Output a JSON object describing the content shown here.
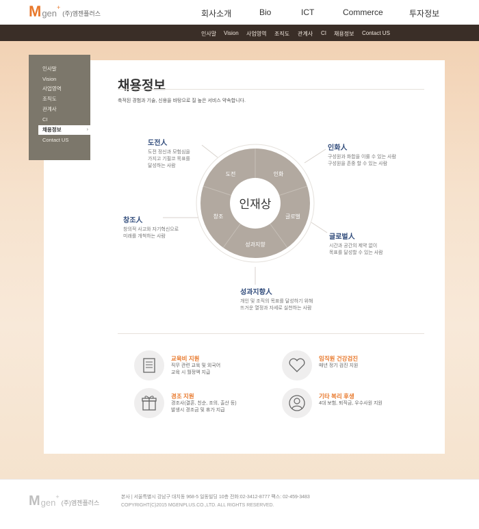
{
  "logo": {
    "m": "M",
    "gen": "gen",
    "plus": "+",
    "corp": "(주)엠젠플러스"
  },
  "gnb": [
    "회사소개",
    "Bio",
    "ICT",
    "Commerce",
    "투자정보"
  ],
  "lnb": [
    "인사말",
    "Vision",
    "사업영역",
    "조직도",
    "관계사",
    "CI",
    "채용정보",
    "Contact US"
  ],
  "side": {
    "items": [
      "인사말",
      "Vision",
      "사업영역",
      "조직도",
      "관계사",
      "CI",
      "채용정보",
      "Contact US"
    ],
    "active_index": 6,
    "active_arrow": "›"
  },
  "page": {
    "title": "채용정보",
    "desc": "축적된 경험과 기술, 신용을 바탕으로 질 높은 서비스 약속합니다."
  },
  "diagram": {
    "center": "인재상",
    "segments": [
      "도전",
      "인화",
      "글로벌",
      "성과지향",
      "창조"
    ]
  },
  "traits": [
    {
      "title": "도전人",
      "desc": [
        "도전 정신과 모험심을",
        "가지고 기필코 목표를",
        "달성하는 사람"
      ]
    },
    {
      "title": "인화人",
      "desc": [
        "구성원과 화합을 이룰 수 있는 사람",
        "구성원을 존중 할 수 있는 사람"
      ]
    },
    {
      "title": "창조人",
      "desc": [
        "창의적 사고와 자기혁신으로",
        "미래를 개척하는 사람"
      ]
    },
    {
      "title": "글로벌人",
      "desc": [
        "시간과 공간의 제약 없이",
        "목표를 달성할 수 있는 사람"
      ]
    },
    {
      "title": "성과지향人",
      "desc": [
        "개인 및 조직의 목표를 달성하기 위해",
        "뜨거운 열정과 자세로 실천하는 사람"
      ]
    }
  ],
  "benefits": [
    {
      "icon": "document-icon",
      "title": "교육비 지원",
      "desc": [
        "직무 관련 교육 및 외국어",
        "교육 시 월정액 지급"
      ]
    },
    {
      "icon": "heart-icon",
      "title": "임직원 건강검진",
      "desc": [
        "매년 정기 검진 지원"
      ]
    },
    {
      "icon": "gift-icon",
      "title": "경조 지원",
      "desc": [
        "경조사(결혼, 친순, 조의, 출산 등)",
        "발생시 경조금 및 휴가 지급"
      ]
    },
    {
      "icon": "person-icon",
      "title": "기타 복리 후생",
      "desc": [
        "4대 보험, 퇴직금, 우수사원 지원"
      ]
    }
  ],
  "footer": {
    "address": "본사  |  서울특별시 강남구 대치동 968-5 일동빌딩 10층     전화:02-3412-8777     팩스: 02-459-3483",
    "copyright": "COPYRIGHT(C)2015 MGENPLUS.CO.,LTD. ALL RIGHTS RESERVED."
  },
  "colors": {
    "accent": "#e8782b",
    "subbar": "#3a2e27",
    "side": "#7c776b",
    "trait_title": "#2f4a7a",
    "ring": "#b2a9a0"
  }
}
